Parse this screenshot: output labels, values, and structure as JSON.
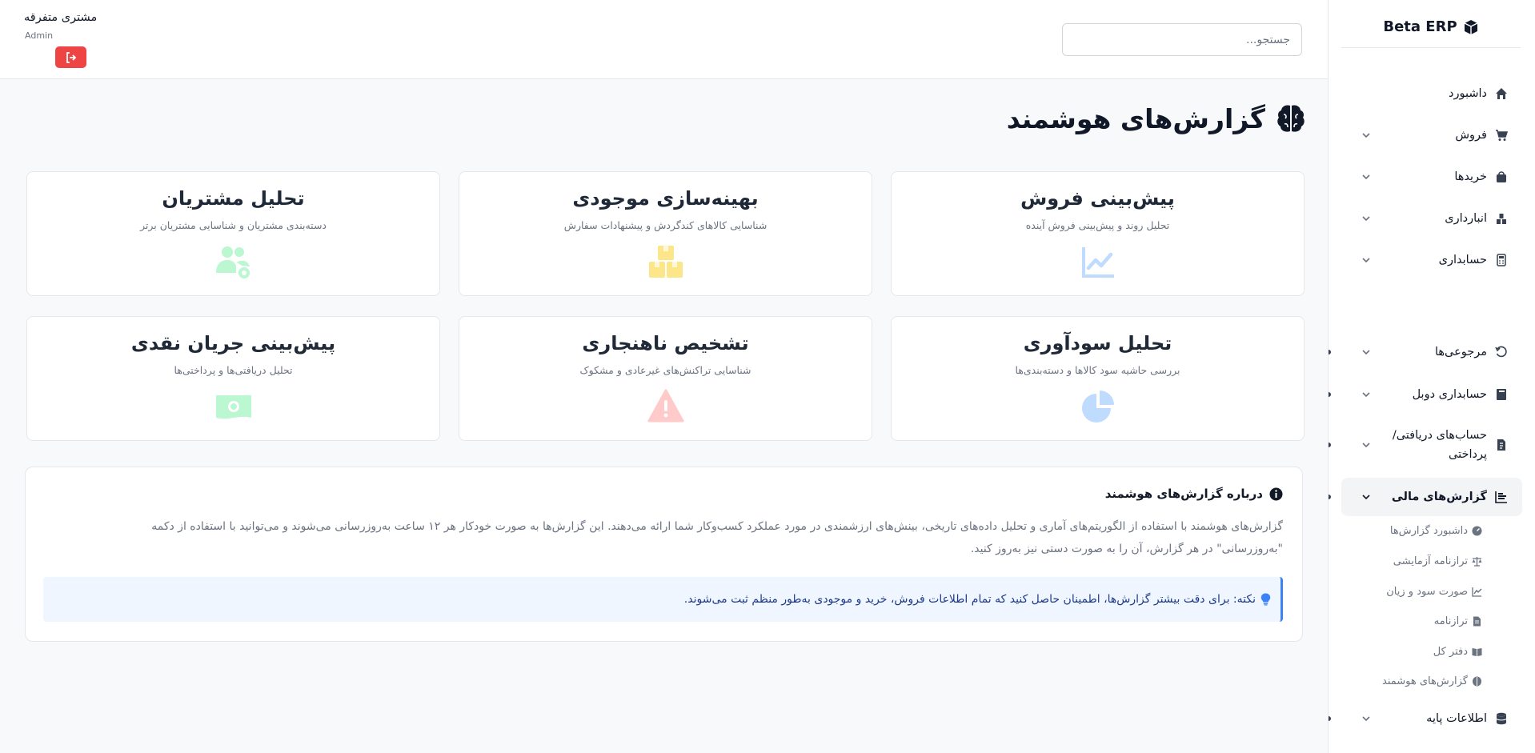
{
  "brand": {
    "name": "Beta ERP",
    "icon": "cube-icon"
  },
  "sidebar": {
    "items": [
      {
        "label": "داشبورد",
        "icon": "home-icon"
      },
      {
        "label": "فروش",
        "icon": "cart-icon"
      },
      {
        "label": "خریدها",
        "icon": "bag-icon"
      },
      {
        "label": "انبارداری",
        "icon": "warehouse-icon"
      },
      {
        "label": "حسابداری",
        "icon": "calculator-icon"
      },
      {
        "label": "مرجوعی‌ها",
        "icon": "undo-icon"
      },
      {
        "label": "حسابداری دوبل",
        "icon": "book-icon"
      },
      {
        "label": "حساب‌های دریافتی/ پرداختی",
        "icon": "invoice-icon"
      },
      {
        "label": "گزارش‌های مالی",
        "icon": "chart-bar-icon"
      },
      {
        "label": "اطلاعات پایه",
        "icon": "database-icon"
      }
    ],
    "sub_items": [
      {
        "label": "داشبورد گزارش‌ها",
        "icon": "gauge-icon"
      },
      {
        "label": "ترازنامه آزمایشی",
        "icon": "scale-icon"
      },
      {
        "label": "صورت سود و زیان",
        "icon": "chart-line-icon"
      },
      {
        "label": "ترازنامه",
        "icon": "file-icon"
      },
      {
        "label": "دفتر کل",
        "icon": "open-book-icon"
      },
      {
        "label": "گزارش‌های هوشمند",
        "icon": "brain-icon"
      }
    ]
  },
  "header": {
    "search_placeholder": "جستجو...",
    "user_name": "مشتری متفرقه",
    "user_role": "Admin",
    "logout_icon": "logout-icon"
  },
  "page": {
    "title": "گزارش‌های هوشمند",
    "title_icon": "brain-icon"
  },
  "cards": [
    {
      "title": "پیش‌بینی فروش",
      "desc": "تحلیل روند و پیش‌بینی فروش آینده",
      "icon": "chart-line-icon",
      "color": "#93c5fd"
    },
    {
      "title": "بهینه‌سازی موجودی",
      "desc": "شناسایی کالاهای کندگردش و پیشنهادات سفارش",
      "icon": "boxes-icon",
      "color": "#fcd34d"
    },
    {
      "title": "تحلیل مشتریان",
      "desc": "دسته‌بندی مشتریان و شناسایی مشتریان برتر",
      "icon": "users-cog-icon",
      "color": "#86efac"
    },
    {
      "title": "تحلیل سودآوری",
      "desc": "بررسی حاشیه سود کالاها و دسته‌بندی‌ها",
      "icon": "pie-chart-icon",
      "color": "#93c5fd"
    },
    {
      "title": "تشخیص ناهنجاری",
      "desc": "شناسایی تراکنش‌های غیرعادی و مشکوک",
      "icon": "warning-icon",
      "color": "#fca5a5"
    },
    {
      "title": "پیش‌بینی جریان نقدی",
      "desc": "تحلیل دریافتی‌ها و پرداختی‌ها",
      "icon": "money-icon",
      "color": "#86efac"
    }
  ],
  "info": {
    "title": "درباره گزارش‌های هوشمند",
    "icon": "info-icon",
    "body": "گزارش‌های هوشمند با استفاده از الگوریتم‌های آماری و تحلیل داده‌های تاریخی، بینش‌های ارزشمندی در مورد عملکرد کسب‌وکار شما ارائه می‌دهند. این گزارش‌ها به صورت خودکار هر ۱۲ ساعت به‌روزرسانی می‌شوند و می‌توانید با استفاده از دکمه \"به‌روزرسانی\" در هر گزارش، آن را به صورت دستی نیز به‌روز کنید.",
    "tip": "نکته: برای دقت بیشتر گزارش‌ها، اطمینان حاصل کنید که تمام اطلاعات فروش، خرید و موجودی به‌طور منظم ثبت می‌شوند.",
    "tip_icon": "lightbulb-icon"
  },
  "colors": {
    "accent": "#3b82f6",
    "danger": "#ef4444",
    "text": "#111827",
    "muted": "#6b7280"
  }
}
